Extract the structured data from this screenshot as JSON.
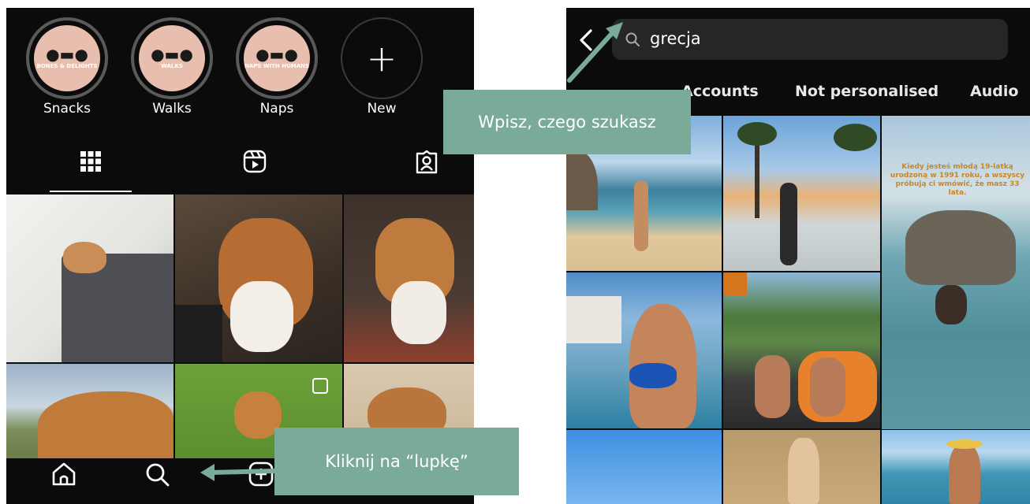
{
  "profile_screen": {
    "highlights": [
      {
        "cover_text": "BONES & DELIGHTS",
        "label": "Snacks"
      },
      {
        "cover_text": "WALKS",
        "label": "Walks"
      },
      {
        "cover_text": "NAPS WITH HUMANS",
        "label": "Naps"
      },
      {
        "cover_text": "",
        "label": "New"
      }
    ],
    "tabs": [
      "grid-icon",
      "reels-icon",
      "tagged-icon"
    ],
    "bottom_nav": [
      "home-icon",
      "search-icon",
      "create-icon"
    ]
  },
  "search_screen": {
    "search_value": "grecja",
    "filter_tabs": [
      "Accounts",
      "Not personalised",
      "Audio"
    ],
    "post_text": "Kiedy jesteś młodą 19-latką urodzoną w 1991 roku, a wszyscy próbują ci wmówić, że masz 33 lata."
  },
  "annotations": {
    "search_hint": "Wpisz, czego szukasz",
    "magnifier_hint": "Kliknij na “lupkę”"
  },
  "colors": {
    "callout": "#7aab99",
    "app_background": "#0b0b0b",
    "highlight_cover": "#e8bfae"
  }
}
